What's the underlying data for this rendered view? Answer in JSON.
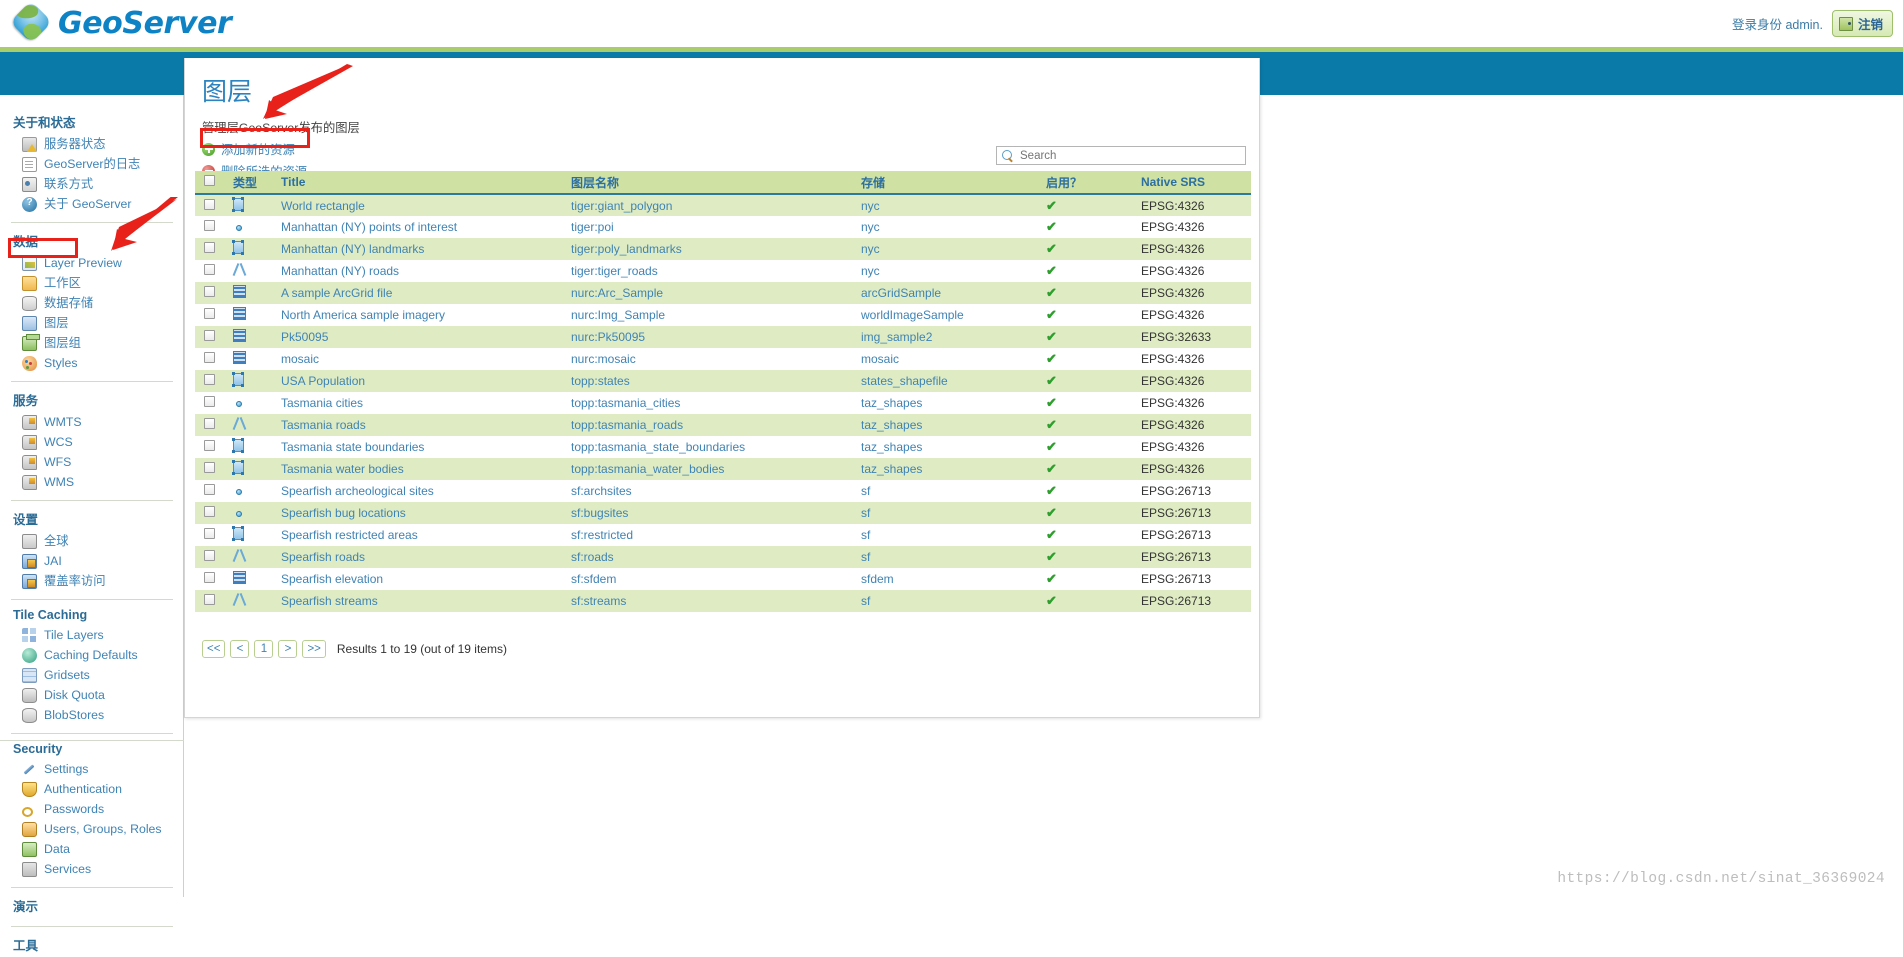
{
  "header": {
    "logo_text": "GeoServer",
    "login_label": "登录身份 admin.",
    "logout_label": "注销"
  },
  "sidebar": {
    "sections": [
      {
        "title": "关于和状态",
        "items": [
          {
            "label": "服务器状态",
            "icon": "server-status-icon"
          },
          {
            "label": "GeoServer的日志",
            "icon": "log-document-icon"
          },
          {
            "label": "联系方式",
            "icon": "contact-card-icon"
          },
          {
            "label": "关于 GeoServer",
            "icon": "about-info-icon"
          }
        ]
      },
      {
        "title": "数据",
        "items": [
          {
            "label": "Layer Preview",
            "icon": "layer-preview-icon"
          },
          {
            "label": "工作区",
            "icon": "folder-icon"
          },
          {
            "label": "数据存储",
            "icon": "database-icon"
          },
          {
            "label": "图层",
            "icon": "layer-icon"
          },
          {
            "label": "图层组",
            "icon": "layer-group-icon"
          },
          {
            "label": "Styles",
            "icon": "palette-icon"
          }
        ]
      },
      {
        "title": "服务",
        "items": [
          {
            "label": "WMTS",
            "icon": "service-icon"
          },
          {
            "label": "WCS",
            "icon": "service-icon"
          },
          {
            "label": "WFS",
            "icon": "service-icon"
          },
          {
            "label": "WMS",
            "icon": "service-icon"
          }
        ]
      },
      {
        "title": "设置",
        "items": [
          {
            "label": "全球",
            "icon": "global-settings-icon"
          },
          {
            "label": "JAI",
            "icon": "jai-icon"
          },
          {
            "label": "覆盖率访问",
            "icon": "coverage-access-icon"
          }
        ]
      },
      {
        "title": "Tile Caching",
        "items": [
          {
            "label": "Tile Layers",
            "icon": "tile-layers-icon"
          },
          {
            "label": "Caching Defaults",
            "icon": "caching-defaults-icon"
          },
          {
            "label": "Gridsets",
            "icon": "gridsets-icon"
          },
          {
            "label": "Disk Quota",
            "icon": "disk-quota-icon"
          },
          {
            "label": "BlobStores",
            "icon": "blobstores-icon"
          }
        ]
      },
      {
        "title": "Security",
        "items": [
          {
            "label": "Settings",
            "icon": "wrench-icon"
          },
          {
            "label": "Authentication",
            "icon": "shield-icon"
          },
          {
            "label": "Passwords",
            "icon": "key-icon"
          },
          {
            "label": "Users, Groups, Roles",
            "icon": "users-icon"
          },
          {
            "label": "Data",
            "icon": "data-security-icon"
          },
          {
            "label": "Services",
            "icon": "services-security-icon"
          }
        ]
      },
      {
        "title": "演示",
        "items": []
      },
      {
        "title": "工具",
        "items": []
      }
    ]
  },
  "page": {
    "title": "图层",
    "subtitle": "管理层GeoServer发布的图层",
    "add_label": "添加新的资源",
    "remove_label": "删除所选的资源"
  },
  "pager": {
    "first": "<<",
    "prev": "<",
    "page": "1",
    "next": ">",
    "last": ">>",
    "info": "Results 1 to 19 (out of 19 items)"
  },
  "search": {
    "placeholder": "Search"
  },
  "table": {
    "headers": {
      "type": "类型",
      "title": "Title",
      "name": "图层名称",
      "store": "存储",
      "enabled": "启用？",
      "srs": "Native SRS"
    },
    "rows": [
      {
        "geom": "polygon",
        "title": "World rectangle",
        "name": "tiger:giant_polygon",
        "store": "nyc",
        "enabled": "✔",
        "srs": "EPSG:4326"
      },
      {
        "geom": "point",
        "title": "Manhattan (NY) points of interest",
        "name": "tiger:poi",
        "store": "nyc",
        "enabled": "✔",
        "srs": "EPSG:4326"
      },
      {
        "geom": "polygon",
        "title": "Manhattan (NY) landmarks",
        "name": "tiger:poly_landmarks",
        "store": "nyc",
        "enabled": "✔",
        "srs": "EPSG:4326"
      },
      {
        "geom": "line",
        "title": "Manhattan (NY) roads",
        "name": "tiger:tiger_roads",
        "store": "nyc",
        "enabled": "✔",
        "srs": "EPSG:4326"
      },
      {
        "geom": "raster",
        "title": "A sample ArcGrid file",
        "name": "nurc:Arc_Sample",
        "store": "arcGridSample",
        "enabled": "✔",
        "srs": "EPSG:4326"
      },
      {
        "geom": "raster",
        "title": "North America sample imagery",
        "name": "nurc:Img_Sample",
        "store": "worldImageSample",
        "enabled": "✔",
        "srs": "EPSG:4326"
      },
      {
        "geom": "raster",
        "title": "Pk50095",
        "name": "nurc:Pk50095",
        "store": "img_sample2",
        "enabled": "✔",
        "srs": "EPSG:32633"
      },
      {
        "geom": "raster",
        "title": "mosaic",
        "name": "nurc:mosaic",
        "store": "mosaic",
        "enabled": "✔",
        "srs": "EPSG:4326"
      },
      {
        "geom": "polygon",
        "title": "USA Population",
        "name": "topp:states",
        "store": "states_shapefile",
        "enabled": "✔",
        "srs": "EPSG:4326"
      },
      {
        "geom": "point",
        "title": "Tasmania cities",
        "name": "topp:tasmania_cities",
        "store": "taz_shapes",
        "enabled": "✔",
        "srs": "EPSG:4326"
      },
      {
        "geom": "line",
        "title": "Tasmania roads",
        "name": "topp:tasmania_roads",
        "store": "taz_shapes",
        "enabled": "✔",
        "srs": "EPSG:4326"
      },
      {
        "geom": "polygon",
        "title": "Tasmania state boundaries",
        "name": "topp:tasmania_state_boundaries",
        "store": "taz_shapes",
        "enabled": "✔",
        "srs": "EPSG:4326"
      },
      {
        "geom": "polygon",
        "title": "Tasmania water bodies",
        "name": "topp:tasmania_water_bodies",
        "store": "taz_shapes",
        "enabled": "✔",
        "srs": "EPSG:4326"
      },
      {
        "geom": "point",
        "title": "Spearfish archeological sites",
        "name": "sf:archsites",
        "store": "sf",
        "enabled": "✔",
        "srs": "EPSG:26713"
      },
      {
        "geom": "point",
        "title": "Spearfish bug locations",
        "name": "sf:bugsites",
        "store": "sf",
        "enabled": "✔",
        "srs": "EPSG:26713"
      },
      {
        "geom": "polygon",
        "title": "Spearfish restricted areas",
        "name": "sf:restricted",
        "store": "sf",
        "enabled": "✔",
        "srs": "EPSG:26713"
      },
      {
        "geom": "line",
        "title": "Spearfish roads",
        "name": "sf:roads",
        "store": "sf",
        "enabled": "✔",
        "srs": "EPSG:26713"
      },
      {
        "geom": "raster",
        "title": "Spearfish elevation",
        "name": "sf:sfdem",
        "store": "sfdem",
        "enabled": "✔",
        "srs": "EPSG:26713"
      },
      {
        "geom": "line",
        "title": "Spearfish streams",
        "name": "sf:streams",
        "store": "sf",
        "enabled": "✔",
        "srs": "EPSG:26713"
      }
    ]
  },
  "watermark": "https://blog.csdn.net/sinat_36369024",
  "colors": {
    "accent_blue": "#0a7ba8",
    "link_blue": "#3f83b4",
    "row_green": "#dfecc3",
    "header_green": "#cfe2a4",
    "annotation_red": "#e8211a"
  }
}
